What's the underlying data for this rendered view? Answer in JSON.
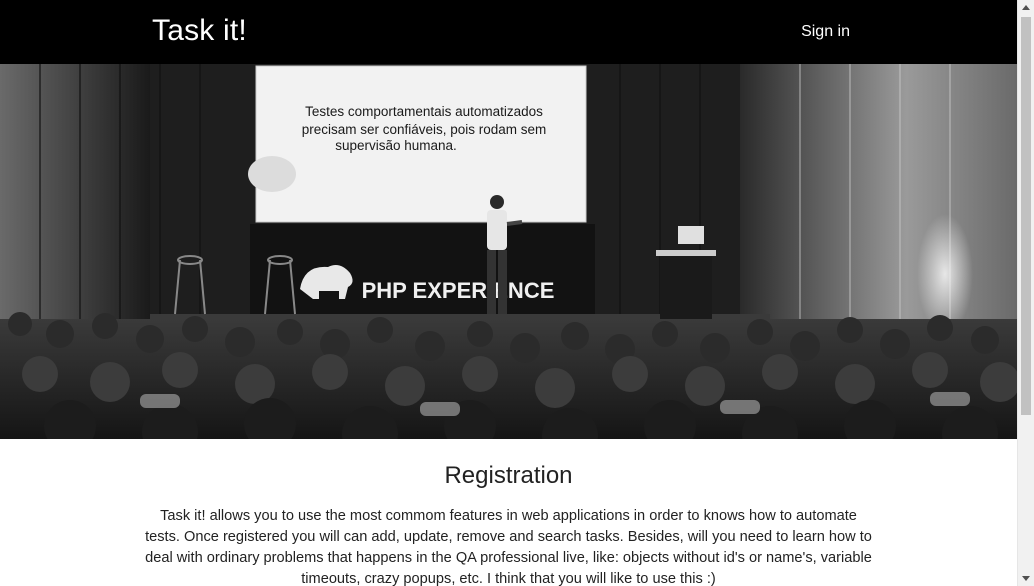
{
  "header": {
    "brand": "Task it!",
    "signin_label": "Sign in"
  },
  "hero": {
    "slide_text": [
      "Testes comportamentais automatizados",
      "precisam ser confiáveis, pois rodam sem",
      "supervisão humana."
    ],
    "stage_banner": "PHP EXPERIENCE"
  },
  "registration": {
    "title": "Registration",
    "description": "Task it! allows you to use the most commom features in web applications in order to knows how to automate tests. Once registered you will can add, update, remove and search tasks. Besides, will you need to learn how to deal with ordinary problems that happens in the QA professional live, like: objects without id's or name's, variable timeouts, crazy popups, etc. I think that you will like to use this :)"
  },
  "colors": {
    "navbar_bg": "#000000",
    "navbar_text": "#ffffff",
    "body_text": "#222222"
  }
}
